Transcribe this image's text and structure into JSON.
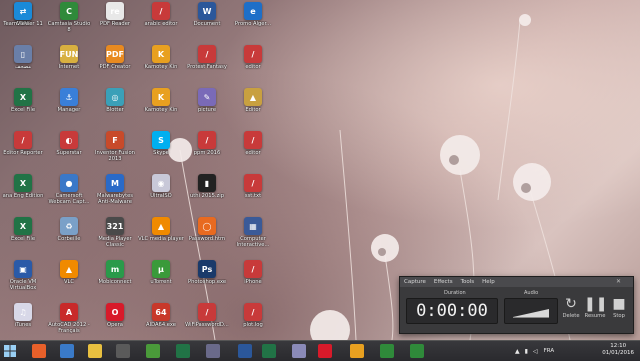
{
  "desktop": {
    "icons": [
      {
        "label": "CCPC",
        "color": "#5a6b8c",
        "glyph": "≡"
      },
      {
        "label": "Camtasia Studio 8",
        "color": "#2f8a3a",
        "glyph": "C"
      },
      {
        "label": "PDF Reader",
        "color": "#e8e8e8",
        "glyph": "re"
      },
      {
        "label": "arabic editor",
        "color": "#c83a3a",
        "glyph": "/"
      },
      {
        "label": "Document",
        "color": "#2b579a",
        "glyph": "W"
      },
      {
        "label": "Promo Alger...",
        "color": "#1e6fc8",
        "glyph": "e"
      },
      {
        "label": "مصحف",
        "color": "#6a7fa8",
        "glyph": "▯"
      },
      {
        "label": "Internet",
        "color": "#d8b040",
        "glyph": "FUN"
      },
      {
        "label": "PDF Creator",
        "color": "#e88a20",
        "glyph": "PDF"
      },
      {
        "label": "Kamotey Kin",
        "color": "#e8a020",
        "glyph": "K"
      },
      {
        "label": "Protest Fantasy",
        "color": "#c83a3a",
        "glyph": "/"
      },
      {
        "label": "editor",
        "color": "#c83a3a",
        "glyph": "/"
      },
      {
        "label": "Excel File",
        "color": "#217346",
        "glyph": "X"
      },
      {
        "label": "Manager",
        "color": "#3a7fd8",
        "glyph": "⚓"
      },
      {
        "label": "Blotter",
        "color": "#3aa0b8",
        "glyph": "◎"
      },
      {
        "label": "Kamotey Kin",
        "color": "#e8a020",
        "glyph": "K"
      },
      {
        "label": "picture",
        "color": "#7a6ab8",
        "glyph": "✎"
      },
      {
        "label": "Editor",
        "color": "#c8a040",
        "glyph": "▲"
      },
      {
        "label": "Editor Reporter",
        "color": "#c83a3a",
        "glyph": "/"
      },
      {
        "label": "Superstar",
        "color": "#c83a3a",
        "glyph": "◐"
      },
      {
        "label": "Inventor Fusion 2013",
        "color": "#c84a2a",
        "glyph": "F"
      },
      {
        "label": "Skype",
        "color": "#00aff0",
        "glyph": "S"
      },
      {
        "label": "ppm 2016",
        "color": "#c83a3a",
        "glyph": "/"
      },
      {
        "label": "editor",
        "color": "#c83a3a",
        "glyph": "/"
      },
      {
        "label": "ana Eng Edition",
        "color": "#217346",
        "glyph": "X"
      },
      {
        "label": "Camersoft Webcam Capt...",
        "color": "#3a78c8",
        "glyph": "●"
      },
      {
        "label": "Malwarebytes Anti-Malware",
        "color": "#2a6ac8",
        "glyph": "M"
      },
      {
        "label": "UltraISO",
        "color": "#c8c8d8",
        "glyph": "◉"
      },
      {
        "label": "uthi 2015.zip",
        "color": "#222222",
        "glyph": "▮"
      },
      {
        "label": "sst.txt",
        "color": "#c83a3a",
        "glyph": "/"
      },
      {
        "label": "Excel File",
        "color": "#217346",
        "glyph": "X"
      },
      {
        "label": "Corbeille",
        "color": "#7aa0c8",
        "glyph": "♻"
      },
      {
        "label": "Media Player Classic",
        "color": "#4a4a4a",
        "glyph": "321"
      },
      {
        "label": "VLC media player",
        "color": "#f08a00",
        "glyph": "▲"
      },
      {
        "label": "Password.htm",
        "color": "#e86a20",
        "glyph": "◯"
      },
      {
        "label": "Computer Interactive...",
        "color": "#3a5a98",
        "glyph": "▦"
      },
      {
        "label": "Oracle VM VirtualBox",
        "color": "#2a5aa8",
        "glyph": "▣"
      },
      {
        "label": "VLC",
        "color": "#f08a00",
        "glyph": "▲"
      },
      {
        "label": "Mobiconnect",
        "color": "#2a9a4a",
        "glyph": "m"
      },
      {
        "label": "uTorrent",
        "color": "#3a9a3a",
        "glyph": "μ"
      },
      {
        "label": "Photoshop.exe",
        "color": "#1a3a6a",
        "glyph": "Ps"
      },
      {
        "label": "iPhone",
        "color": "#c83a3a",
        "glyph": "/"
      },
      {
        "label": "iTunes",
        "color": "#d8d8e8",
        "glyph": "♫"
      },
      {
        "label": "AutoCAD 2012 - Français",
        "color": "#c82a2a",
        "glyph": "A"
      },
      {
        "label": "Opera",
        "color": "#d81a2a",
        "glyph": "O"
      },
      {
        "label": "AIDA64.exe",
        "color": "#c8382a",
        "glyph": "64"
      },
      {
        "label": "WiFiPasswordD...",
        "color": "#c83a3a",
        "glyph": "/"
      },
      {
        "label": "plot.log",
        "color": "#c83a3a",
        "glyph": "/"
      },
      {
        "label": "TeamViewer 11",
        "color": "#1a8ad8",
        "glyph": "⇄"
      }
    ]
  },
  "capture_widget": {
    "menu": [
      "Capture",
      "Effects",
      "Tools",
      "Help"
    ],
    "close_glyph": "✕",
    "duration_label": "Duration",
    "duration_value": "0:00:00",
    "audio_label": "Audio",
    "controls": [
      {
        "label": "Delete",
        "glyph": "↻"
      },
      {
        "label": "Resume",
        "glyph": "❚❚"
      },
      {
        "label": "Stop",
        "glyph": "■"
      }
    ]
  },
  "taskbar": {
    "language": "FRA",
    "time": "12:10",
    "date": "01/01/2016",
    "apps": [
      {
        "name": "firefox",
        "color": "#e8602a"
      },
      {
        "name": "computer",
        "color": "#3a7ac8"
      },
      {
        "name": "explorer",
        "color": "#e8c040"
      },
      {
        "name": "media",
        "color": "#5a5a5a"
      },
      {
        "name": "chrome",
        "color": "#4a9a3a"
      },
      {
        "name": "excel",
        "color": "#217346"
      },
      {
        "name": "settings",
        "color": "#6a6a8a"
      },
      {
        "name": "word",
        "color": "#2b579a"
      },
      {
        "name": "excel-2",
        "color": "#217346"
      },
      {
        "name": "editor",
        "color": "#8a8ab8"
      },
      {
        "name": "opera",
        "color": "#d81a2a"
      },
      {
        "name": "kin",
        "color": "#e8a020"
      },
      {
        "name": "camtasia",
        "color": "#2f8a3a"
      },
      {
        "name": "camtasia-rec",
        "color": "#2f8a3a"
      }
    ]
  }
}
